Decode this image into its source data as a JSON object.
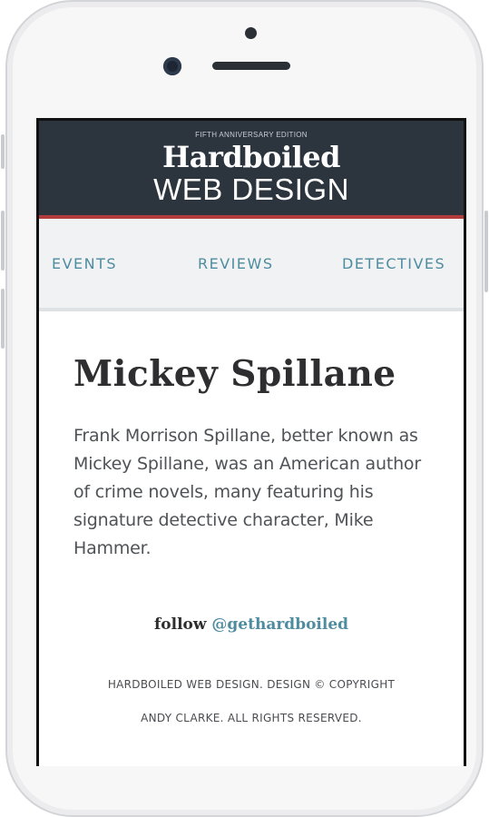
{
  "site": {
    "edition_label": "FIFTH ANNIVERSARY EDITION",
    "title_line1": "Hardboiled",
    "title_line2": "WEB DESIGN"
  },
  "nav": {
    "items": [
      {
        "label": "EVENTS"
      },
      {
        "label": "REVIEWS"
      },
      {
        "label": "DETECTIVES"
      }
    ]
  },
  "article": {
    "heading": "Mickey Spillane",
    "body": "Frank Morrison Spillane, better known as Mickey Spillane, was an American author of crime novels, many featuring his signature detective character, Mike Hammer."
  },
  "follow": {
    "word": "follow",
    "handle": "@gethardboiled"
  },
  "footer": {
    "line1": "HARDBOILED WEB DESIGN. DESIGN © COPYRIGHT",
    "line2": "ANDY CLARKE. ALL RIGHTS RESERVED."
  },
  "colors": {
    "masthead_bg": "#2c343d",
    "accent_red": "#b23b3b",
    "link_teal": "#4e8ca0"
  }
}
